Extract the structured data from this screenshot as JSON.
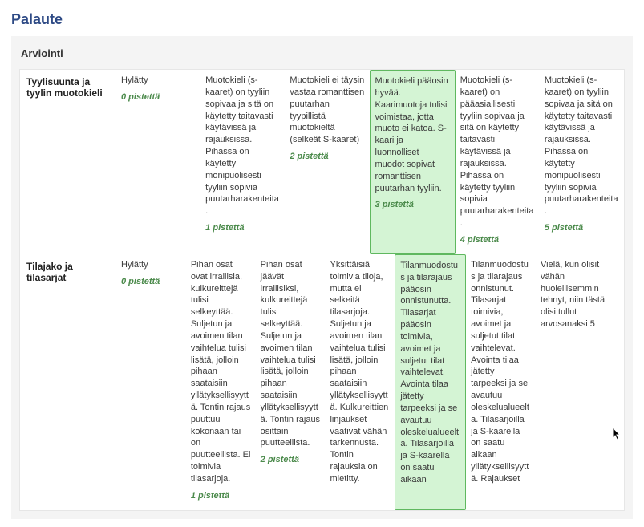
{
  "page": {
    "title": "Palaute",
    "panel_heading": "Arviointi"
  },
  "rubric": {
    "rows": [
      {
        "criterion": "Tyylisuunta ja tyylin muotokieli",
        "selected_index": 3,
        "comment": "",
        "levels": [
          {
            "desc": "Hylätty",
            "points": "0 pistettä"
          },
          {
            "desc": "Muotokieli (s-kaaret) on tyyliin sopivaa ja sitä on käytetty taitavasti käytävissä ja rajauksissa. Pihassa on käytetty monipuolisesti tyyliin sopivia puutarharakenteita.",
            "points": "1 pistettä"
          },
          {
            "desc": "Muotokieli ei täysin vastaa romanttisen puutarhan tyypillistä muotokieltä (selkeät S-kaaret)",
            "points": "2 pistettä"
          },
          {
            "desc": "Muotokieli pääosin hyvää. Kaarimuotoja tulisi voimistaa, jotta muoto ei katoa. S-kaari ja luonnolliset muodot sopivat romanttisen puutarhan tyyliin.",
            "points": "3 pistettä"
          },
          {
            "desc": "Muotokieli (s-kaaret) on pääasiallisesti tyyliin sopivaa ja sitä on käytetty taitavasti käytävissä ja rajauksissa. Pihassa on käytetty tyyliin sopivia puutarharakenteita.",
            "points": "4 pistettä"
          },
          {
            "desc": "Muotokieli (s-kaaret) on tyyliin sopivaa ja sitä on käytetty taitavasti käytävissä ja rajauksissa. Pihassa on käytetty monipuolisesti tyyliin sopivia puutarharakenteita.",
            "points": "5 pistettä"
          }
        ]
      },
      {
        "criterion": "Tilajako ja tilasarjat",
        "selected_index": 4,
        "comment": "Vielä, kun olisit vähän huolellisemmin tehnyt, niin tästä olisi tullut arvosanaksi 5",
        "levels": [
          {
            "desc": "Hylätty",
            "points": "0 pistettä"
          },
          {
            "desc": "Pihan osat ovat irrallisia, kulkureittejä tulisi selkeyttää. Suljetun ja avoimen tilan vaihtelua tulisi lisätä, jolloin pihaan saataisiin yllätyksellisyyttä. Tontin rajaus puuttuu kokonaan tai on puutteellista. Ei toimivia tilasarjoja.",
            "points": "1 pistettä"
          },
          {
            "desc": "Pihan osat jäävät irrallisiksi, kulkureittejä tulisi selkeyttää. Suljetun ja avoimen tilan vaihtelua tulisi lisätä, jolloin pihaan saataisiin yllätyksellisyyttä. Tontin rajaus osittain puutteellista.",
            "points": "2 pistettä"
          },
          {
            "desc": "Yksittäisiä toimivia tiloja, mutta ei selkeitä tilasarjoja. Suljetun ja avoimen tilan vaihtelua tulisi lisätä, jolloin pihaan saataisiin yllätyksellisyyttä. Kulkureittien linjaukset vaativat vähän tarkennusta. Tontin rajauksia on mietitty.",
            "points": ""
          },
          {
            "desc": "Tilanmuodostus ja tilarajaus pääosin onnistunutta. Tilasarjat pääosin toimivia, avoimet ja suljetut tilat vaihtelevat. Avointa tilaa jätetty tarpeeksi ja se avautuu oleskelualueelta. Tilasarjoilla ja S-kaarella on saatu aikaan",
            "points": ""
          },
          {
            "desc": "Tilanmuodostus ja tilarajaus onnistunut. Tilasarjat toimivia, avoimet ja suljetut tilat vaihtelevat. Avointa tilaa jätetty tarpeeksi ja se avautuu oleskelualueelta. Tilasarjoilla ja S-kaarella on saatu aikaan yllätyksellisyyttä. Rajaukset",
            "points": ""
          }
        ]
      }
    ]
  }
}
